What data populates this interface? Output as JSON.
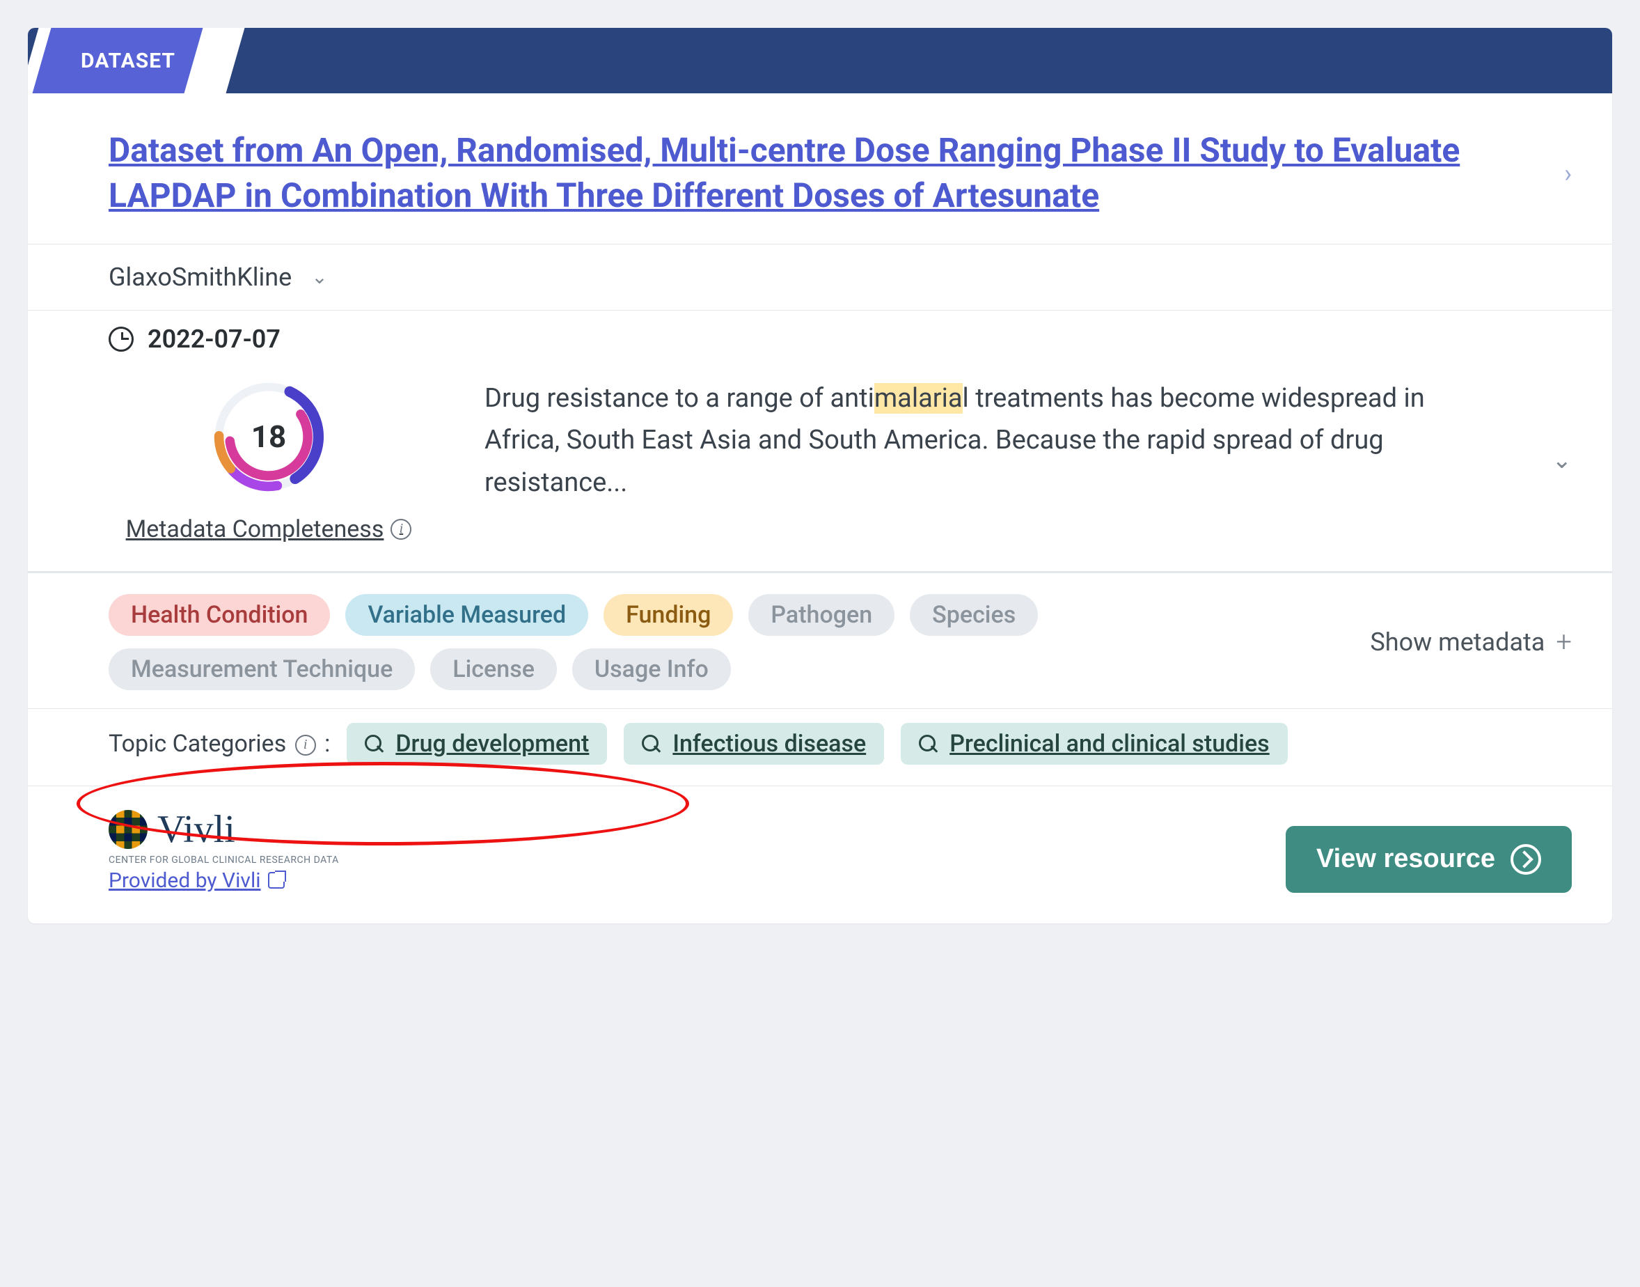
{
  "badge": "DATASET",
  "title": "Dataset from An Open, Randomised, Multi-centre Dose Ranging Phase II Study to Evaluate LAPDAP in Combination With Three Different Doses of Artesunate",
  "organization": "GlaxoSmithKline",
  "date": "2022-07-07",
  "completeness": {
    "score": "18",
    "label": "Metadata Completeness"
  },
  "description": {
    "pre": "Drug resistance to a range of anti",
    "highlight": "malaria",
    "post": "l treatments has become widespread in Africa, South East Asia and South America. Because the rapid spread of drug resistance..."
  },
  "tags": [
    {
      "label": "Health Condition",
      "style": "red"
    },
    {
      "label": "Variable Measured",
      "style": "blue"
    },
    {
      "label": "Funding",
      "style": "amber"
    },
    {
      "label": "Pathogen",
      "style": "grey"
    },
    {
      "label": "Species",
      "style": "grey"
    },
    {
      "label": "Measurement Technique",
      "style": "grey"
    },
    {
      "label": "License",
      "style": "grey"
    },
    {
      "label": "Usage Info",
      "style": "grey"
    }
  ],
  "show_metadata": "Show metadata",
  "topics": {
    "label": "Topic Categories",
    "items": [
      "Drug development",
      "Infectious disease",
      "Preclinical and clinical studies"
    ]
  },
  "provider": {
    "name": "Vivli",
    "subtitle": "CENTER FOR GLOBAL CLINICAL RESEARCH DATA",
    "link_text": "Provided by Vivli"
  },
  "view_button": "View resource"
}
